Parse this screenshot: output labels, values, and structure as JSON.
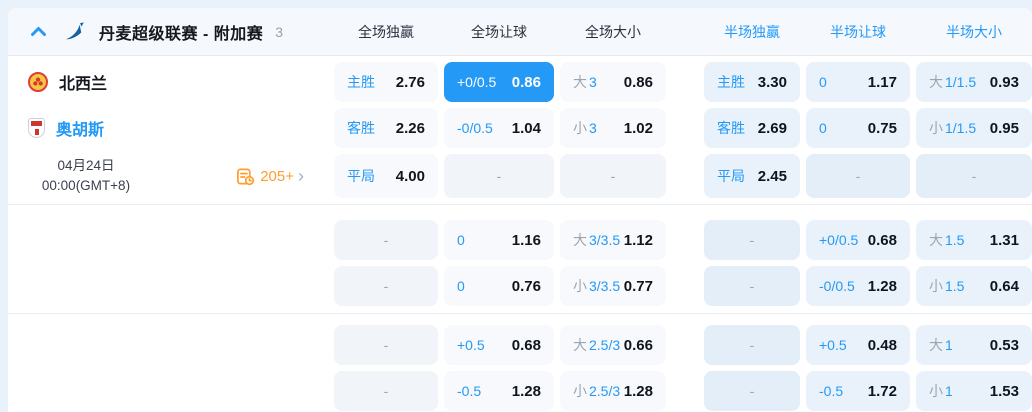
{
  "colors": {
    "accent": "#2499f5",
    "orange": "#ff9d2e"
  },
  "header": {
    "league_title": "丹麦超级联赛 - 附加赛",
    "match_count": "3",
    "columns": [
      {
        "label": "全场独赢",
        "scope": "full"
      },
      {
        "label": "全场让球",
        "scope": "full"
      },
      {
        "label": "全场大小",
        "scope": "full"
      },
      {
        "label": "半场独赢",
        "scope": "half"
      },
      {
        "label": "半场让球",
        "scope": "half"
      },
      {
        "label": "半场大小",
        "scope": "half"
      }
    ]
  },
  "left": {
    "home_team": "北西兰",
    "away_team": "奥胡斯",
    "date": "04月24日",
    "time": "00:00(GMT+8)",
    "more_markets": "205+",
    "more_markets_arrow": "›"
  },
  "odds": {
    "groups": [
      {
        "rows": [
          {
            "cells": [
              {
                "type": "ml",
                "scope": "full",
                "label": "主胜",
                "value": "2.76"
              },
              {
                "type": "hc",
                "scope": "full",
                "label": "+0/0.5",
                "value": "0.86",
                "highlight": true
              },
              {
                "type": "ou",
                "scope": "full",
                "prefix": "大",
                "line": "3",
                "value": "0.86"
              },
              {
                "type": "ml",
                "scope": "half",
                "label": "主胜",
                "value": "3.30"
              },
              {
                "type": "hc",
                "scope": "half",
                "label": "0",
                "value": "1.17"
              },
              {
                "type": "ou",
                "scope": "half",
                "prefix": "大",
                "line": "1/1.5",
                "value": "0.93"
              }
            ]
          },
          {
            "cells": [
              {
                "type": "ml",
                "scope": "full",
                "label": "客胜",
                "value": "2.26"
              },
              {
                "type": "hc",
                "scope": "full",
                "label": "-0/0.5",
                "value": "1.04"
              },
              {
                "type": "ou",
                "scope": "full",
                "prefix": "小",
                "line": "3",
                "value": "1.02"
              },
              {
                "type": "ml",
                "scope": "half",
                "label": "客胜",
                "value": "2.69"
              },
              {
                "type": "hc",
                "scope": "half",
                "label": "0",
                "value": "0.75"
              },
              {
                "type": "ou",
                "scope": "half",
                "prefix": "小",
                "line": "1/1.5",
                "value": "0.95"
              }
            ]
          },
          {
            "cells": [
              {
                "type": "ml",
                "scope": "full",
                "label": "平局",
                "value": "4.00"
              },
              {
                "type": "dash",
                "scope": "full"
              },
              {
                "type": "dash",
                "scope": "full"
              },
              {
                "type": "ml",
                "scope": "half",
                "label": "平局",
                "value": "2.45"
              },
              {
                "type": "dash",
                "scope": "half"
              },
              {
                "type": "dash",
                "scope": "half"
              }
            ]
          }
        ]
      },
      {
        "rows": [
          {
            "cells": [
              {
                "type": "dash",
                "scope": "full"
              },
              {
                "type": "hc",
                "scope": "full",
                "label": "0",
                "value": "1.16"
              },
              {
                "type": "ou",
                "scope": "full",
                "prefix": "大",
                "line": "3/3.5",
                "value": "1.12"
              },
              {
                "type": "dash",
                "scope": "half"
              },
              {
                "type": "hc",
                "scope": "half",
                "label": "+0/0.5",
                "value": "0.68"
              },
              {
                "type": "ou",
                "scope": "half",
                "prefix": "大",
                "line": "1.5",
                "value": "1.31"
              }
            ]
          },
          {
            "cells": [
              {
                "type": "dash",
                "scope": "full"
              },
              {
                "type": "hc",
                "scope": "full",
                "label": "0",
                "value": "0.76"
              },
              {
                "type": "ou",
                "scope": "full",
                "prefix": "小",
                "line": "3/3.5",
                "value": "0.77"
              },
              {
                "type": "dash",
                "scope": "half"
              },
              {
                "type": "hc",
                "scope": "half",
                "label": "-0/0.5",
                "value": "1.28"
              },
              {
                "type": "ou",
                "scope": "half",
                "prefix": "小",
                "line": "1.5",
                "value": "0.64"
              }
            ]
          }
        ]
      },
      {
        "rows": [
          {
            "cells": [
              {
                "type": "dash",
                "scope": "full"
              },
              {
                "type": "hc",
                "scope": "full",
                "label": "+0.5",
                "value": "0.68"
              },
              {
                "type": "ou",
                "scope": "full",
                "prefix": "大",
                "line": "2.5/3",
                "value": "0.66"
              },
              {
                "type": "dash",
                "scope": "half"
              },
              {
                "type": "hc",
                "scope": "half",
                "label": "+0.5",
                "value": "0.48"
              },
              {
                "type": "ou",
                "scope": "half",
                "prefix": "大",
                "line": "1",
                "value": "0.53"
              }
            ]
          },
          {
            "cells": [
              {
                "type": "dash",
                "scope": "full"
              },
              {
                "type": "hc",
                "scope": "full",
                "label": "-0.5",
                "value": "1.28"
              },
              {
                "type": "ou",
                "scope": "full",
                "prefix": "小",
                "line": "2.5/3",
                "value": "1.28"
              },
              {
                "type": "dash",
                "scope": "half"
              },
              {
                "type": "hc",
                "scope": "half",
                "label": "-0.5",
                "value": "1.72"
              },
              {
                "type": "ou",
                "scope": "half",
                "prefix": "小",
                "line": "1",
                "value": "1.53"
              }
            ]
          }
        ]
      }
    ]
  }
}
